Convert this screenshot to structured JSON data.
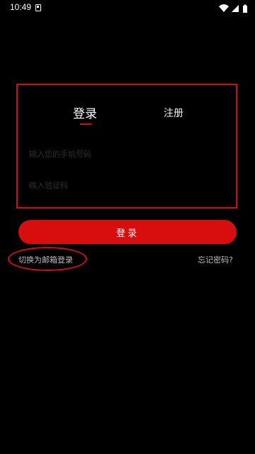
{
  "status_bar": {
    "time": "10:49",
    "icons": [
      "notification-icon",
      "wifi-icon",
      "signal-icon",
      "battery-icon"
    ]
  },
  "auth_tabs": {
    "login_label": "登录",
    "register_label": "注册",
    "active": "login"
  },
  "form": {
    "phone_placeholder": "输入您的手机号码",
    "code_placeholder": "输入验证码"
  },
  "actions": {
    "login_button": "登录",
    "switch_email": "切换为邮箱登录",
    "forgot_password": "忘记密码?"
  },
  "colors": {
    "accent": "#d80d0d",
    "annotation": "#d01010",
    "background": "#000000"
  }
}
